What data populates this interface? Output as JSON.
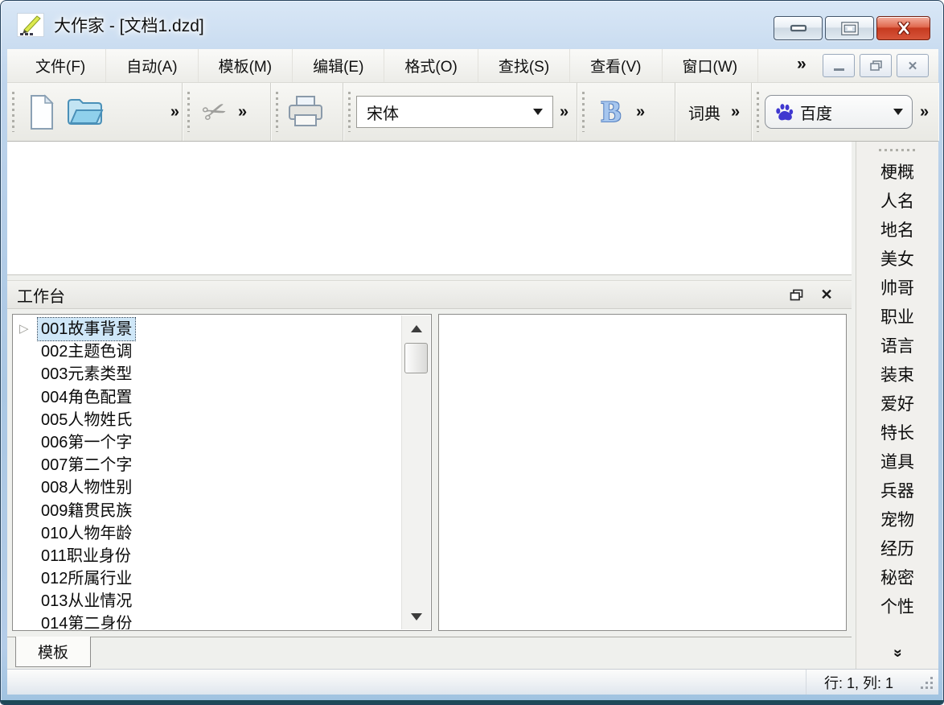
{
  "window": {
    "title": "大作家 - [文档1.dzd]"
  },
  "menubar": {
    "items": [
      "文件(F)",
      "自动(A)",
      "模板(M)",
      "编辑(E)",
      "格式(O)",
      "查找(S)",
      "查看(V)",
      "窗口(W)"
    ]
  },
  "toolbar": {
    "font_name_value": "宋体",
    "bold_letter": "B",
    "dictionary_label": "词典",
    "search_engine_value": "百度"
  },
  "workbench": {
    "title": "工作台",
    "selected_index": 0,
    "items": [
      "001故事背景",
      "002主题色调",
      "003元素类型",
      "004角色配置",
      "005人物姓氏",
      "006第一个字",
      "007第二个字",
      "008人物性别",
      "009籍贯民族",
      "010人物年龄",
      "011职业身份",
      "012所属行业",
      "013从业情况",
      "014第二身份"
    ]
  },
  "sidebar": {
    "items": [
      "梗概",
      "人名",
      "地名",
      "美女",
      "帅哥",
      "职业",
      "语言",
      "装束",
      "爱好",
      "特长",
      "道具",
      "兵器",
      "宠物",
      "经历",
      "秘密",
      "个性"
    ]
  },
  "tabs": {
    "items": [
      "模板"
    ]
  },
  "statusbar": {
    "position": "行: 1, 列: 1"
  },
  "glyphs": {
    "overflow_chevron": "»",
    "more_chevron": "»",
    "scissors": "✂",
    "expander_triangle": "▷",
    "close_x": "✕"
  },
  "colors": {
    "titlebar_blue": "#b6cfe9",
    "close_button_red": "#cf4733",
    "selection_blue": "#cfe7f8",
    "baidu_paw_blue": "#4038d0",
    "bold_letter_blue": "#9cc0ec"
  }
}
